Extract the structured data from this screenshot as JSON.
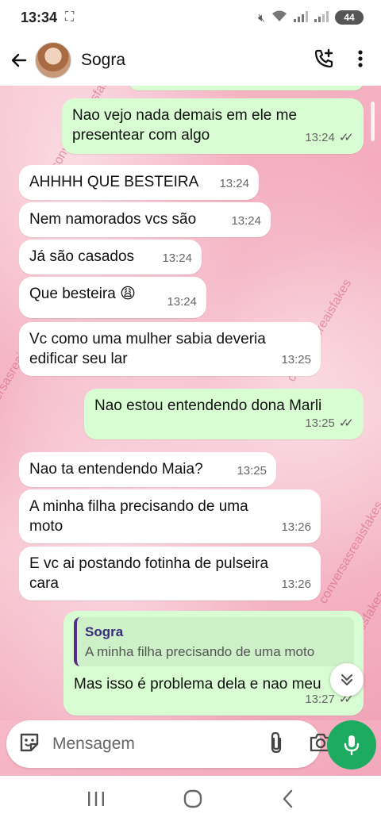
{
  "status_bar": {
    "time": "13:34",
    "battery": "44"
  },
  "header": {
    "contact_name": "Sogra"
  },
  "messages": [
    {
      "dir": "out",
      "text": "Nao vejo nada demais em ele me presentear com algo",
      "time": "13:24"
    },
    {
      "dir": "in",
      "text": "AHHHH QUE BESTEIRA",
      "time": "13:24"
    },
    {
      "dir": "in",
      "text": "Nem namorados vcs são",
      "time": "13:24"
    },
    {
      "dir": "in",
      "text": "Já são casados",
      "time": "13:24"
    },
    {
      "dir": "in",
      "text": "Que besteira 😩",
      "time": "13:24"
    },
    {
      "dir": "in",
      "text": "Vc como uma mulher sabia deveria edificar seu lar",
      "time": "13:25"
    },
    {
      "dir": "out",
      "text": "Nao estou entendendo dona Marli",
      "time": "13:25"
    },
    {
      "dir": "in",
      "text": "Nao ta entendendo Maia?",
      "time": "13:25"
    },
    {
      "dir": "in",
      "text": "A minha filha precisando de uma moto",
      "time": "13:26"
    },
    {
      "dir": "in",
      "text": "E vc ai postando fotinha de pulseira cara",
      "time": "13:26"
    },
    {
      "dir": "out",
      "text": "Mas isso é problema dela e nao meu",
      "time": "13:27",
      "reply_to": {
        "name": "Sogra",
        "text": "A minha filha precisando de uma moto"
      }
    }
  ],
  "watermark": [
    "@conversasreaisfakes",
    "conversasreaisfakes",
    "@conversasreaisfakes",
    "conversasreaisfakes",
    "@conversasreaisfakes"
  ],
  "composer": {
    "placeholder": "Mensagem"
  },
  "icons": {
    "back": "arrow-left-icon",
    "call": "add-call-icon",
    "menu": "more-vertical-icon",
    "sticker": "sticker-icon",
    "attach": "paperclip-icon",
    "camera": "camera-icon",
    "mic": "microphone-icon",
    "scroll": "double-chevron-down-icon"
  },
  "colors": {
    "outgoing_bubble": "#d9fdd3",
    "incoming_bubble": "#ffffff",
    "mic_button": "#1daa61",
    "reply_bar": "#5b2a8a"
  }
}
